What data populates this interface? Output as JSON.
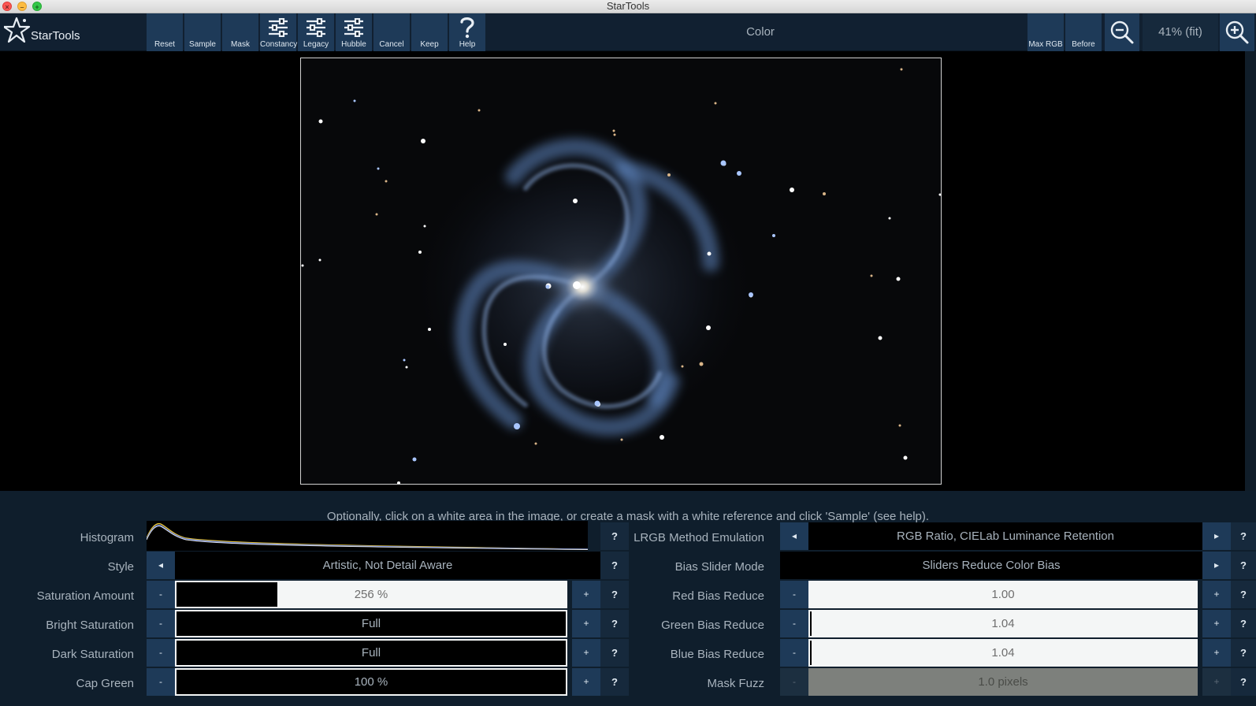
{
  "window": {
    "title": "StarTools"
  },
  "app": {
    "name": "StarTools"
  },
  "toolbar": {
    "buttons": [
      {
        "label": "Reset"
      },
      {
        "label": "Sample"
      },
      {
        "label": "Mask"
      },
      {
        "label": "Constancy"
      },
      {
        "label": "Legacy"
      },
      {
        "label": "Hubble"
      },
      {
        "label": "Cancel"
      },
      {
        "label": "Keep"
      },
      {
        "label": "Help"
      }
    ],
    "module_title": "Color",
    "max_rgb_label": "Max RGB",
    "before_label": "Before",
    "zoom_level": "41% (fit)",
    "icons": {
      "zoom_out": "zoom-out-icon",
      "zoom_in": "zoom-in-icon",
      "logo": "star-logo-icon",
      "sliders": "sliders-icon",
      "help": "question-icon"
    }
  },
  "panel": {
    "instructions": "Optionally, click on a white area in the image, or create a mask with a white reference and click 'Sample' (see help).",
    "help_glyph": "?",
    "left": {
      "histogram_label": "Histogram",
      "style": {
        "label": "Style",
        "value": "Artistic, Not Detail Aware"
      },
      "saturation_amount": {
        "label": "Saturation Amount",
        "value": "256 %",
        "fill": 0.26
      },
      "bright_saturation": {
        "label": "Bright Saturation",
        "value": "Full",
        "fill": 1.0
      },
      "dark_saturation": {
        "label": "Dark Saturation",
        "value": "Full",
        "fill": 1.0
      },
      "cap_green": {
        "label": "Cap Green",
        "value": "100 %",
        "fill": 1.0
      }
    },
    "right": {
      "lrgb_method": {
        "label": "LRGB Method Emulation",
        "value": "RGB Ratio, CIELab Luminance Retention"
      },
      "bias_slider_mode": {
        "label": "Bias Slider Mode",
        "value": "Sliders Reduce Color Bias"
      },
      "red_bias": {
        "label": "Red Bias Reduce",
        "value": "1.00",
        "fill": 0.0
      },
      "green_bias": {
        "label": "Green Bias Reduce",
        "value": "1.04",
        "fill": 0.004
      },
      "blue_bias": {
        "label": "Blue Bias Reduce",
        "value": "1.04",
        "fill": 0.004
      },
      "mask_fuzz": {
        "label": "Mask Fuzz",
        "value": "1.0 pixels",
        "fill": 0.0
      }
    },
    "minus_glyph": "-",
    "plus_glyph": "+",
    "left_arrow": "◂",
    "right_arrow": "▸"
  }
}
